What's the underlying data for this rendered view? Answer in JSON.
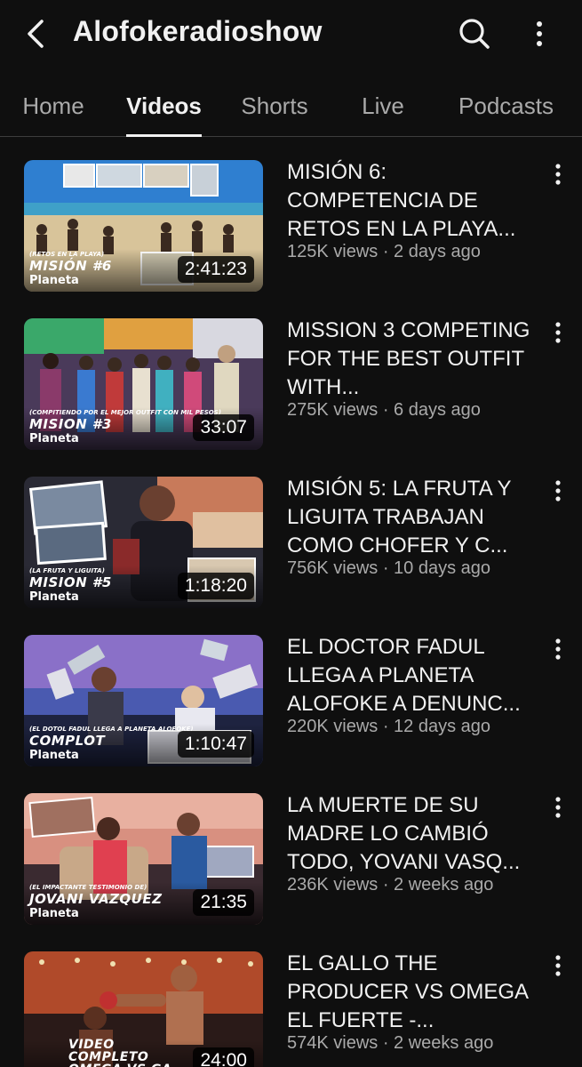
{
  "header": {
    "title": "Alofokeradioshow",
    "back_icon": "back-arrow-icon",
    "search_icon": "search-icon",
    "more_icon": "more-vertical-icon"
  },
  "tabs": [
    {
      "label": "Home",
      "active": false
    },
    {
      "label": "Videos",
      "active": true
    },
    {
      "label": "Shorts",
      "active": false
    },
    {
      "label": "Live",
      "active": false
    },
    {
      "label": "Podcasts",
      "active": false
    }
  ],
  "videos": [
    {
      "title": "MISIÓN 6: COMPETENCIA DE RETOS EN LA PLAYA...",
      "stats": "125K views · 2 days ago",
      "duration": "2:41:23",
      "thumb_small": "(RETOS EN LA PLAYA)",
      "thumb_big": "MISIÓN #6",
      "thumb_logo": "Planeta",
      "colors": {
        "sky": "#2f7fd0",
        "ground": "#d8c49a",
        "accent": "#1a3f6e"
      }
    },
    {
      "title": "MISSION 3 COMPETING FOR THE BEST OUTFIT WITH...",
      "stats": "275K views · 6 days ago",
      "duration": "33:07",
      "thumb_small": "(COMPITIENDO POR EL MEJOR OUTFIT CON MIL PESOS)",
      "thumb_big": "MISION #3",
      "thumb_logo": "Planeta",
      "colors": {
        "sky": "#3aa86a",
        "ground": "#5a3a6b",
        "accent": "#e0a040"
      }
    },
    {
      "title": "MISIÓN 5: LA FRUTA Y LIGUITA TRABAJAN COMO CHOFER Y C...",
      "stats": "756K views · 10 days ago",
      "duration": "1:18:20",
      "thumb_small": "(LA FRUTA Y LIGUITA)",
      "thumb_big": "MISION #5",
      "thumb_logo": "Planeta",
      "colors": {
        "sky": "#c87a5a",
        "ground": "#2a2a35",
        "accent": "#8a2a2a"
      }
    },
    {
      "title": "EL DOCTOR FADUL LLEGA A PLANETA ALOFOKE A DENUNC...",
      "stats": "220K views · 12 days ago",
      "duration": "1:10:47",
      "thumb_small": "(EL DOTOL FADUL LLEGA A PLANETA ALOFOKE)",
      "thumb_big": "COMPLOT",
      "thumb_logo": "Planeta",
      "colors": {
        "sky": "#5a6ab8",
        "ground": "#1e2340",
        "accent": "#b05ab0"
      }
    },
    {
      "title": "LA MUERTE DE SU MADRE LO CAMBIÓ TODO, YOVANI VASQ...",
      "stats": "236K views · 2 weeks ago",
      "duration": "21:35",
      "thumb_small": "(EL IMPACTANTE TESTIMONIO DE)",
      "thumb_big": "JOVANI VAZQUEZ",
      "thumb_logo": "Planeta",
      "colors": {
        "sky": "#d89080",
        "ground": "#3a2a30",
        "accent": "#2a5aa0"
      }
    },
    {
      "title": "EL GALLO THE PRODUCER VS OMEGA EL FUERTE -...",
      "stats": "574K views · 2 weeks ago",
      "duration": "24:00",
      "thumb_small": "",
      "thumb_big": "VIDEO COMPLETO OMEGA VS GA",
      "thumb_logo": "",
      "colors": {
        "sky": "#b04a2a",
        "ground": "#2a1a18",
        "accent": "#e0b070"
      }
    }
  ]
}
